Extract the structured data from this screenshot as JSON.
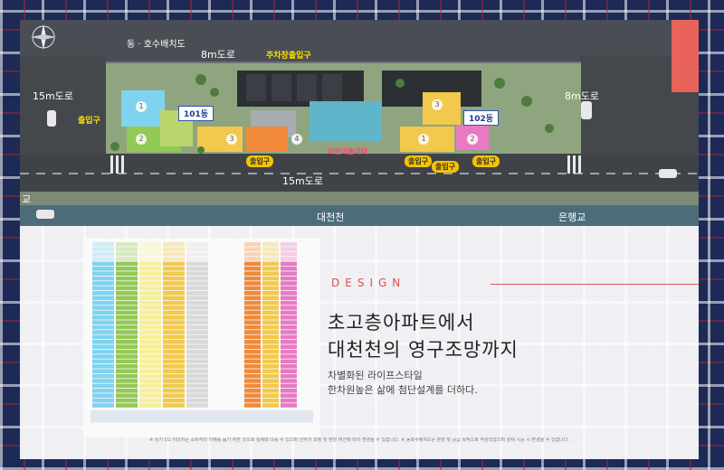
{
  "site_plan": {
    "labels": {
      "dong_stamp": "동 · 호수배치도",
      "road_top": "8m도로",
      "parking_entrance": "주차장출입구",
      "road_left": "15m도로",
      "entrance_left": "출입구",
      "building_101": "101동",
      "building_102": "102동",
      "kids_cafe": "어린이놀이터",
      "road_right": "8m도로",
      "entrance_bottom_1": "출입구",
      "entrance_bottom_2": "출입구",
      "entrance_bottom_3": "출입구",
      "entrance_bottom_4": "출입구",
      "road_bottom": "15m도로",
      "river": "대천천",
      "bridge_left": "교",
      "bridge_right": "은행교"
    },
    "unit_numbers": [
      "1",
      "2",
      "3",
      "4",
      "3",
      "1",
      "2"
    ],
    "colors": {
      "unit1": "#7fd3f0",
      "unit2": "#93c955",
      "unit3": "#f2c94c",
      "unit4": "#f08a3a",
      "unit2b": "#e77ac3",
      "accent_red": "#e8635a"
    }
  },
  "design_section": {
    "eyebrow": "DESIGN",
    "headline_1": "초고층아파트에서",
    "headline_2": "대천천의 영구조망까지",
    "sub_1": "차별화된 라이프스타일",
    "sub_2": "한차원높은 삶에 첨단설계를 더하다."
  },
  "footnote": "※ 상기 CG 이미지는 소비자의 이해를 돕기 위한 것으로 실제와 다를 수 있으며 인허가 과정 및 현장 여건에 따라 변경될 수 있습니다. ※ 동호수배치도는 분양 및 공급 목적으로 작성되었으며 실제 시공 시 변경될 수 있습니다."
}
